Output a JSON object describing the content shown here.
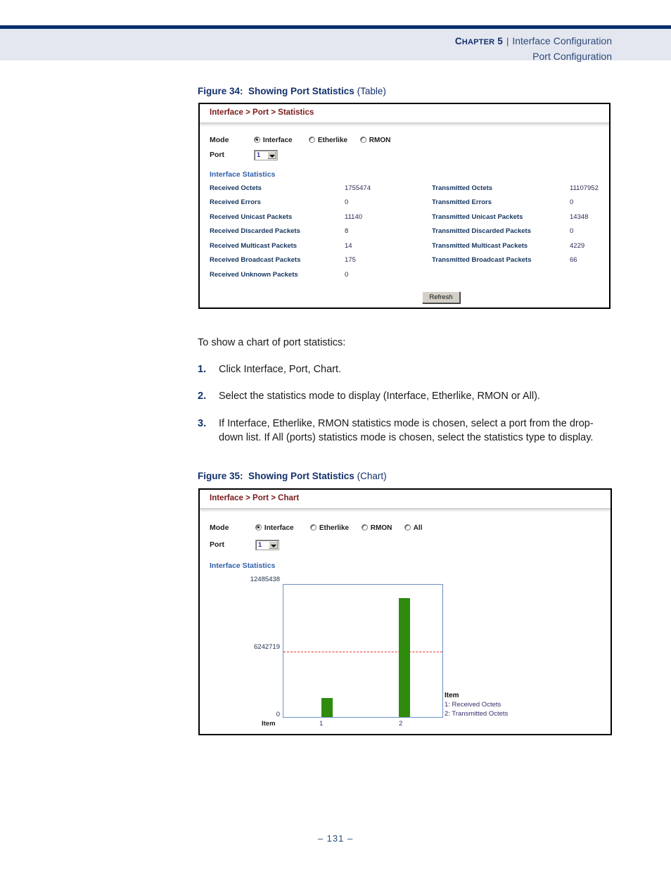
{
  "header": {
    "chapter_prefix": "C",
    "chapter_rest": "HAPTER",
    "chapter_label": "CHAPTER 5",
    "chapter_number": "5",
    "separator": "|",
    "title": "Interface Configuration",
    "subtitle": "Port Configuration"
  },
  "figure34": {
    "label": "Figure 34:",
    "title": "Showing Port Statistics",
    "variant": "(Table)",
    "panel_title": "Interface > Port > Statistics",
    "mode_label": "Mode",
    "port_label": "Port",
    "modes": [
      {
        "label": "Interface",
        "selected": true
      },
      {
        "label": "Etherlike",
        "selected": false
      },
      {
        "label": "RMON",
        "selected": false
      }
    ],
    "port_value": "1",
    "section_title": "Interface Statistics",
    "left_stats": [
      {
        "name": "Received Octets",
        "value": "1755474"
      },
      {
        "name": "Received Errors",
        "value": "0"
      },
      {
        "name": "Received Unicast Packets",
        "value": "11140"
      },
      {
        "name": "Received Discarded Packets",
        "value": "8"
      },
      {
        "name": "Received Multicast Packets",
        "value": "14"
      },
      {
        "name": "Received Broadcast Packets",
        "value": "175"
      },
      {
        "name": "Received Unknown Packets",
        "value": "0"
      }
    ],
    "right_stats": [
      {
        "name": "Transmitted Octets",
        "value": "11107952"
      },
      {
        "name": "Transmitted Errors",
        "value": "0"
      },
      {
        "name": "Transmitted Unicast Packets",
        "value": "14348"
      },
      {
        "name": "Transmitted Discarded Packets",
        "value": "0"
      },
      {
        "name": "Transmitted Multicast Packets",
        "value": "4229"
      },
      {
        "name": "Transmitted Broadcast Packets",
        "value": "66"
      }
    ],
    "refresh_label": "Refresh"
  },
  "instructions": {
    "intro": "To show a chart of port statistics:",
    "steps": [
      {
        "num": "1.",
        "text": "Click Interface, Port, Chart."
      },
      {
        "num": "2.",
        "text": "Select the statistics mode to display (Interface, Etherlike, RMON or All)."
      },
      {
        "num": "3.",
        "text": "If Interface, Etherlike, RMON statistics mode is chosen, select a port from the drop-down list. If All (ports) statistics mode is chosen, select the statistics type to display."
      }
    ]
  },
  "figure35": {
    "label": "Figure 35:",
    "title": "Showing Port Statistics",
    "variant": "(Chart)",
    "panel_title": "Interface > Port > Chart",
    "mode_label": "Mode",
    "port_label": "Port",
    "modes": [
      {
        "label": "Interface",
        "selected": true
      },
      {
        "label": "Etherlike",
        "selected": false
      },
      {
        "label": "RMON",
        "selected": false
      },
      {
        "label": "All",
        "selected": false
      }
    ],
    "port_value": "1",
    "section_title": "Interface Statistics",
    "legend_title": "Item",
    "legend_items": [
      "1: Received Octets",
      "2: Transmitted Octets"
    ]
  },
  "chart_data": {
    "type": "bar",
    "title": "Interface Statistics",
    "xlabel": "Item",
    "ylabel": "",
    "categories": [
      "1",
      "2"
    ],
    "values": [
      1755474,
      11107952
    ],
    "series": [
      {
        "name": "Interface Statistics",
        "values": [
          1755474,
          11107952
        ]
      }
    ],
    "point_labels": [
      "1: Received Octets",
      "2: Transmitted Octets"
    ],
    "ytick_labels": [
      "12485438",
      "6242719",
      "0"
    ],
    "ytick_values": [
      12485438,
      6242719,
      0
    ],
    "ylim": [
      0,
      12485438
    ],
    "xtick_labels": [
      "1",
      "2"
    ],
    "gridlines": [
      {
        "value": 6242719,
        "style": "dashed",
        "color": "#e8332a"
      }
    ],
    "grid": true,
    "legend_position": "right",
    "bar_color": "#2e8b0e",
    "axis_color": "#6d8fc4"
  },
  "footer": {
    "page_number": "–  131  –"
  }
}
